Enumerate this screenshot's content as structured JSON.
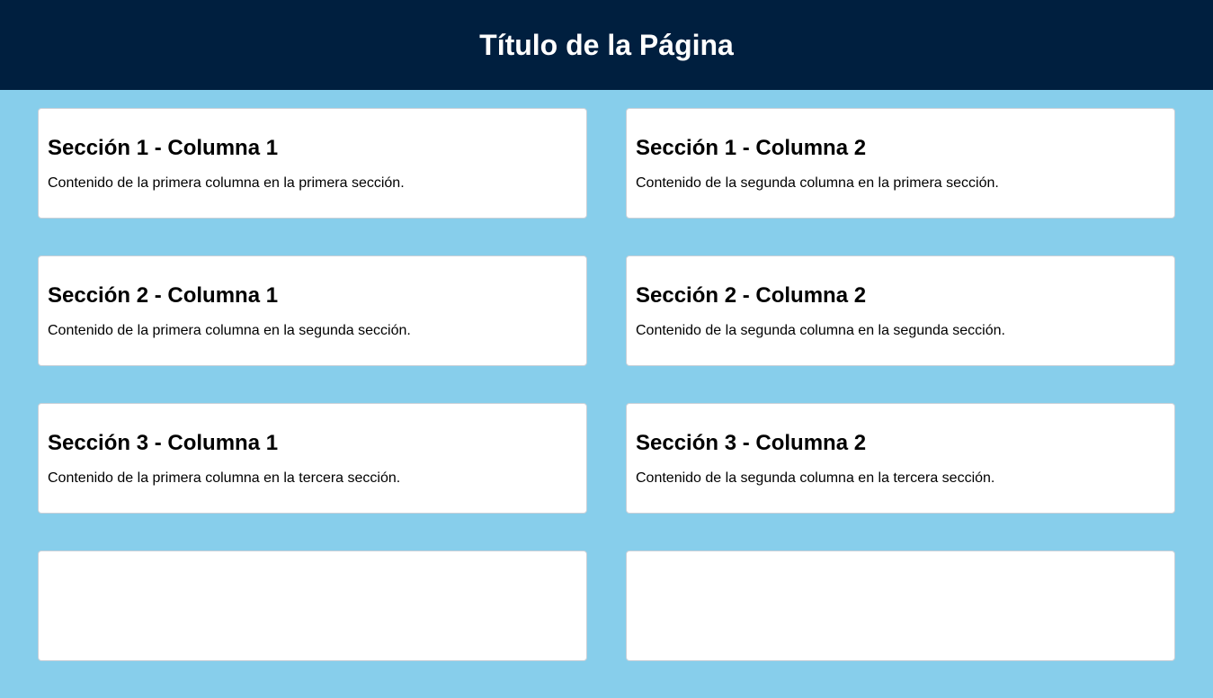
{
  "header": {
    "title": "Título de la Página"
  },
  "sections": [
    {
      "columns": [
        {
          "title": "Sección 1 - Columna 1",
          "text": "Contenido de la primera columna en la primera sección."
        },
        {
          "title": "Sección 1 - Columna 2",
          "text": "Contenido de la segunda columna en la primera sección."
        }
      ]
    },
    {
      "columns": [
        {
          "title": "Sección 2 - Columna 1",
          "text": "Contenido de la primera columna en la segunda sección."
        },
        {
          "title": "Sección 2 - Columna 2",
          "text": "Contenido de la segunda columna en la segunda sección."
        }
      ]
    },
    {
      "columns": [
        {
          "title": "Sección 3 - Columna 1",
          "text": "Contenido de la primera columna en la tercera sección."
        },
        {
          "title": "Sección 3 - Columna 2",
          "text": "Contenido de la segunda columna en la tercera sección."
        }
      ]
    },
    {
      "columns": [
        {
          "title": "",
          "text": ""
        },
        {
          "title": "",
          "text": ""
        }
      ]
    }
  ]
}
